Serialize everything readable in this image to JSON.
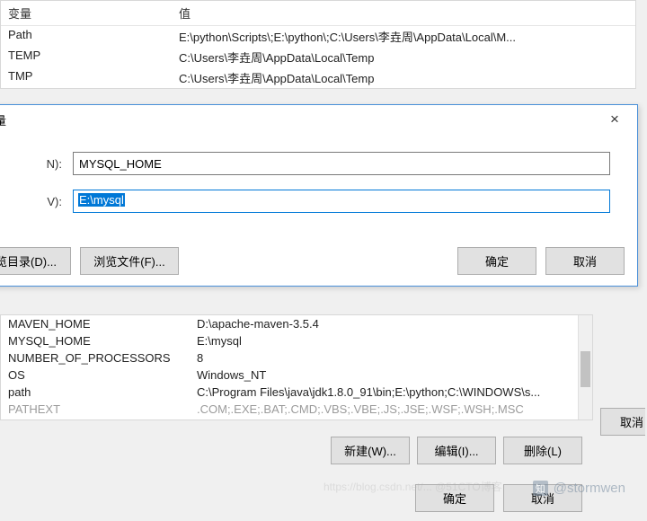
{
  "upper_table": {
    "header_var": "变量",
    "header_val": "值",
    "rows": [
      {
        "var": "Path",
        "val": "E:\\python\\Scripts\\;E:\\python\\;C:\\Users\\李垚周\\AppData\\Local\\M..."
      },
      {
        "var": "TEMP",
        "val": "C:\\Users\\李垚周\\AppData\\Local\\Temp"
      },
      {
        "var": "TMP",
        "val": "C:\\Users\\李垚周\\AppData\\Local\\Temp"
      }
    ]
  },
  "dialog": {
    "title_fragment": "变量",
    "label_name": "N):",
    "label_value": "V):",
    "input_name": "MYSQL_HOME",
    "input_value": "E:\\mysql",
    "browse_dir": "览目录(D)...",
    "browse_file": "浏览文件(F)...",
    "ok": "确定",
    "cancel": "取消"
  },
  "lower_table": {
    "rows": [
      {
        "var": "MAVEN_HOME",
        "val": "D:\\apache-maven-3.5.4"
      },
      {
        "var": "MYSQL_HOME",
        "val": "E:\\mysql"
      },
      {
        "var": "NUMBER_OF_PROCESSORS",
        "val": "8"
      },
      {
        "var": "OS",
        "val": "Windows_NT"
      },
      {
        "var": "path",
        "val": "C:\\Program Files\\java\\jdk1.8.0_91\\bin;E:\\python;C:\\WINDOWS\\s..."
      },
      {
        "var": "PATHEXT",
        "val": ".COM;.EXE;.BAT;.CMD;.VBS;.VBE;.JS;.JSE;.WSF;.WSH;.MSC"
      }
    ]
  },
  "lower_buttons": {
    "new": "新建(W)...",
    "edit": "编辑(I)...",
    "delete": "删除(L)"
  },
  "side_cancel": "取消",
  "bottom": {
    "ok": "确定",
    "cancel": "取消"
  },
  "watermark": {
    "icon": "知",
    "text": "@stormwen"
  },
  "faint_watermark": "https://blog.csdn.net/...   @51CTO博客"
}
